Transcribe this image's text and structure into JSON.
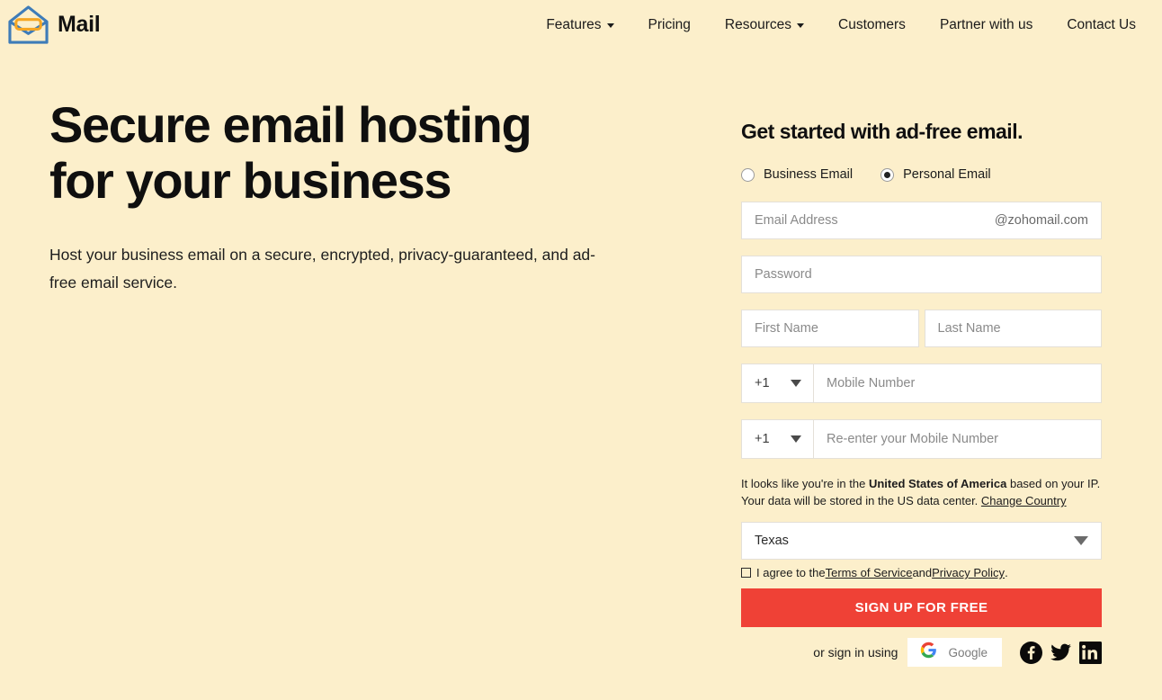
{
  "header": {
    "brand_name": "Mail",
    "logo_icon": "envelope-logo-icon",
    "nav": [
      {
        "label": "Features",
        "has_caret": true
      },
      {
        "label": "Pricing",
        "has_caret": false
      },
      {
        "label": "Resources",
        "has_caret": true
      },
      {
        "label": "Customers",
        "has_caret": false
      },
      {
        "label": "Partner with us",
        "has_caret": false
      },
      {
        "label": "Contact Us",
        "has_caret": false
      }
    ]
  },
  "hero": {
    "heading_line1": "Secure email hosting",
    "heading_line2": "for your business",
    "subtext": "Host your business email on a secure, encrypted, privacy-guaranteed, and ad-free email service."
  },
  "signup": {
    "title": "Get started with ad-free email.",
    "account_type": {
      "business_label": "Business Email",
      "personal_label": "Personal Email",
      "selected": "Personal Email"
    },
    "email": {
      "placeholder": "Email Address",
      "value": "",
      "domain_suffix": "@zohomail.com"
    },
    "password": {
      "placeholder": "Password",
      "value": ""
    },
    "first_name": {
      "placeholder": "First Name",
      "value": ""
    },
    "last_name": {
      "placeholder": "Last Name",
      "value": ""
    },
    "mobile": {
      "country_code": "+1",
      "placeholder": "Mobile Number",
      "value": ""
    },
    "mobile_confirm": {
      "country_code": "+1",
      "placeholder": "Re-enter your Mobile Number",
      "value": ""
    },
    "ip_notice": {
      "part1": "It looks like you're in the ",
      "country": "United States of America",
      "part2": " based on your IP. Your data will be stored in the US data center. ",
      "change_link": "Change Country"
    },
    "state_select": {
      "value": "Texas",
      "icon": "chevron-down-icon"
    },
    "terms": {
      "checked": false,
      "prefix": "I agree to the ",
      "tos_link": "Terms of Service",
      "middle": " and ",
      "privacy_link": "Privacy Policy",
      "suffix": "."
    },
    "cta_label": "SIGN UP FOR FREE",
    "social": {
      "label": "or sign in using",
      "google_label": "Google",
      "providers": [
        "google-icon",
        "facebook-icon",
        "twitter-icon",
        "linkedin-icon"
      ]
    }
  },
  "colors": {
    "background": "#fcefcb",
    "cta_red": "#ef4136",
    "logo_blue": "#3e7cb8",
    "logo_orange": "#f5a623",
    "field_white": "#ffffff",
    "text_dark": "#1a1a1a",
    "placeholder_gray": "#8a8a8a"
  }
}
